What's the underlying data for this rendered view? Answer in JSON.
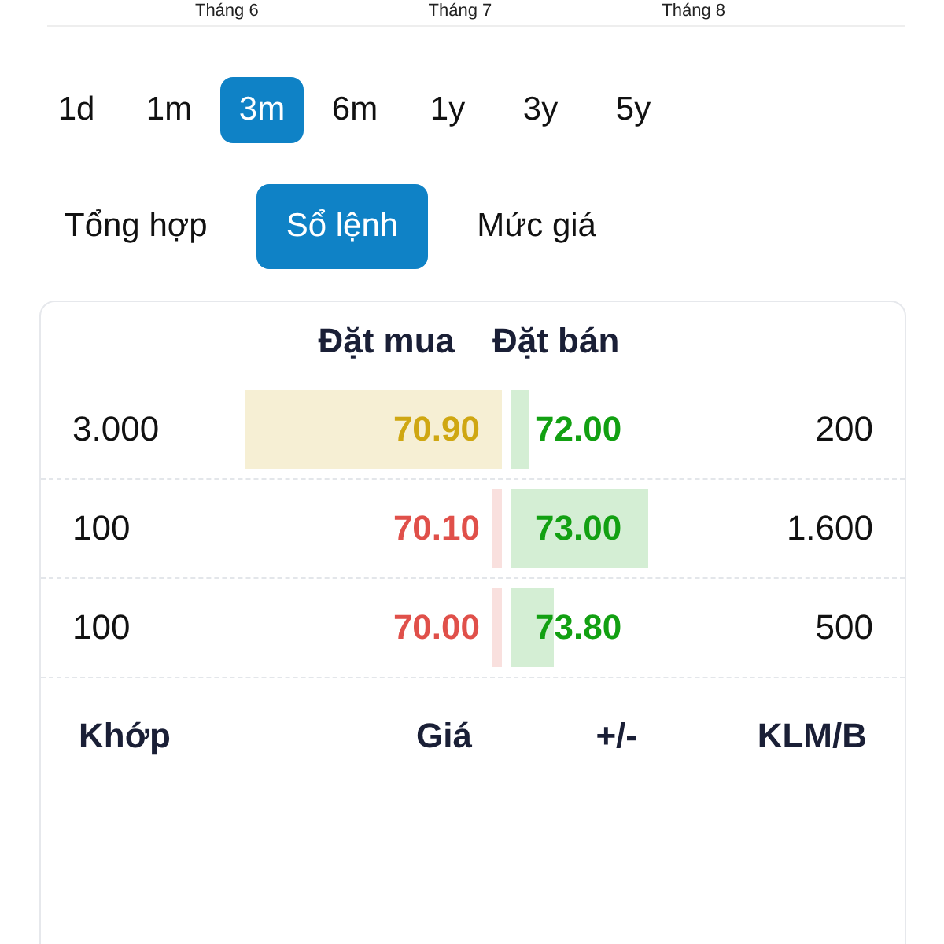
{
  "chart_axis": {
    "labels": [
      "Tháng 6",
      "Tháng 7",
      "Tháng 8"
    ]
  },
  "ranges": [
    {
      "label": "1d",
      "selected": false
    },
    {
      "label": "1m",
      "selected": false
    },
    {
      "label": "3m",
      "selected": true
    },
    {
      "label": "6m",
      "selected": false
    },
    {
      "label": "1y",
      "selected": false
    },
    {
      "label": "3y",
      "selected": false
    },
    {
      "label": "5y",
      "selected": false
    }
  ],
  "tabs": [
    {
      "label": "Tổng hợp",
      "selected": false
    },
    {
      "label": "Sổ lệnh",
      "selected": true
    },
    {
      "label": "Mức giá",
      "selected": false
    }
  ],
  "order_book": {
    "headers": [
      "Đặt mua",
      "Đặt bán"
    ],
    "rows": [
      {
        "bid_volume": "3.000",
        "bid": {
          "price": "70.90",
          "color": "#cfa712"
        },
        "ask": {
          "price": "72.00",
          "color": "#12a012"
        },
        "ask_volume": "200"
      },
      {
        "bid_volume": "100",
        "bid": {
          "price": "70.10",
          "color": "#e0504a"
        },
        "ask": {
          "price": "73.00",
          "color": "#12a012"
        },
        "ask_volume": "1.600"
      },
      {
        "bid_volume": "100",
        "bid": {
          "price": "70.00",
          "color": "#e0504a"
        },
        "ask": {
          "price": "73.80",
          "color": "#12a012"
        },
        "ask_volume": "500"
      }
    ]
  },
  "trades": {
    "columns": [
      "Khớp",
      "Giá",
      "+/-",
      "KLM/B"
    ]
  }
}
